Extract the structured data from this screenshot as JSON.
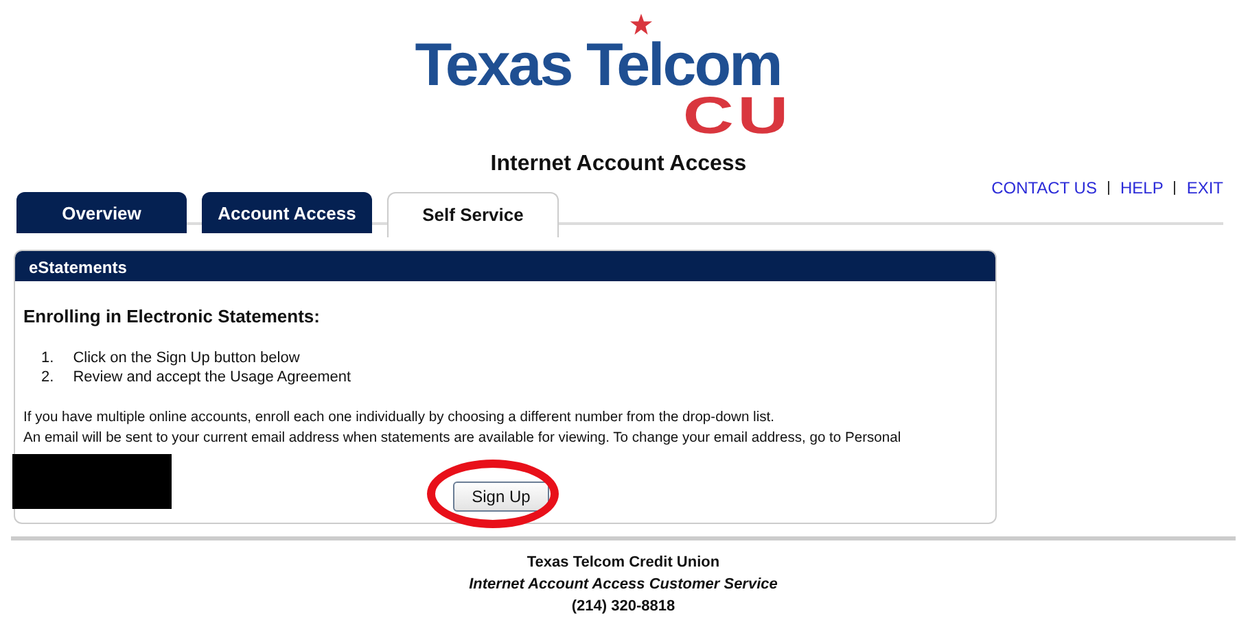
{
  "logo": {
    "wordmark": "Texas Telcom",
    "suffix": "CU"
  },
  "page_title": "Internet Account Access",
  "top_links": [
    "CONTACT US",
    "HELP",
    "EXIT"
  ],
  "tabs": [
    {
      "label": "Overview",
      "selected": false
    },
    {
      "label": "Account Access",
      "selected": false
    },
    {
      "label": "Self Service",
      "selected": true
    }
  ],
  "panel": {
    "title": "eStatements",
    "heading": "Enrolling in Electronic Statements:",
    "steps": [
      {
        "number": "1.",
        "text": "Click on the Sign Up button below"
      },
      {
        "number": "2.",
        "text": "Review and accept the Usage Agreement"
      }
    ],
    "paragraphs": [
      "If you have multiple online accounts, enroll each one individually by choosing a different number from the drop-down list.",
      "An email will be sent to your current email address when statements are available for viewing. To change your email address, go to Personal"
    ],
    "button": "Sign Up"
  },
  "footer": {
    "name": "Texas Telcom Credit Union",
    "service": "Internet Account Access Customer Service",
    "phone": "(214) 320-8818"
  }
}
